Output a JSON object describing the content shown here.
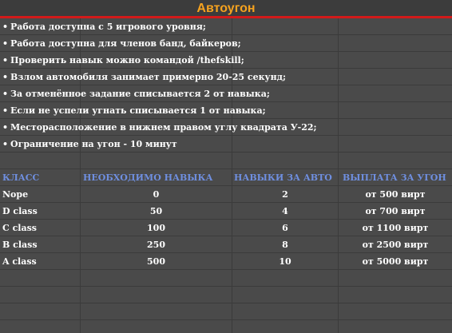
{
  "header": {
    "title": "Автоугон"
  },
  "rules": [
    "Работа доступна с 5 игрового уровня;",
    "Работа доступна для членов банд, байкеров;",
    "Проверить навык можно командой /thefskill;",
    "Взлом автомобиля занимает примерно 20-25 секунд;",
    "За отменённое задание списывается 2 от навыка;",
    "Если не успели угнать списывается 1 от навыка;",
    "Месторасположение в нижнем правом углу квадрата У-22;",
    "Ограничение на угон - 10 минут"
  ],
  "bullet": "•",
  "table": {
    "headers": [
      "КЛАСС",
      "НЕОБХОДИМО НАВЫКА",
      "НАВЫКИ ЗА АВТО",
      "ВЫПЛАТА ЗА УГОН"
    ],
    "rows": [
      [
        "Nope",
        "0",
        "2",
        "от 500 вирт"
      ],
      [
        "D class",
        "50",
        "4",
        "от 700 вирт"
      ],
      [
        "C class",
        "100",
        "6",
        "от 1100 вирт"
      ],
      [
        "B class",
        "250",
        "8",
        "от 2500 вирт"
      ],
      [
        "A class",
        "500",
        "10",
        "от 5000 вирт"
      ]
    ]
  },
  "colors": {
    "title": "#f5a21f",
    "accent_line": "#d21a1a",
    "table_header": "#6f8fe0",
    "background": "#4a4a4a"
  }
}
